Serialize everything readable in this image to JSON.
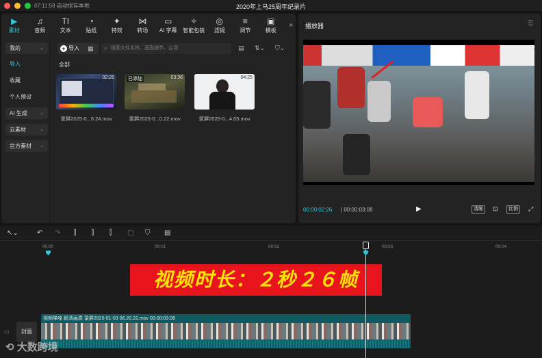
{
  "titlebar": {
    "time": "07:11:58",
    "autosave": "自动保存本地",
    "project_title": "2020年上马25周年纪录片"
  },
  "toolbar": [
    {
      "label": "素材",
      "icon": "media-icon",
      "glyph": "▶",
      "active": true
    },
    {
      "label": "音频",
      "icon": "audio-icon",
      "glyph": "♫"
    },
    {
      "label": "文本",
      "icon": "text-icon",
      "glyph": "TI"
    },
    {
      "label": "贴纸",
      "icon": "sticker-icon",
      "glyph": "◔"
    },
    {
      "label": "特效",
      "icon": "effects-icon",
      "glyph": "✦"
    },
    {
      "label": "转场",
      "icon": "transition-icon",
      "glyph": "⋈"
    },
    {
      "label": "AI 字幕",
      "icon": "ai-subtitle-icon",
      "glyph": "▭"
    },
    {
      "label": "智能包装",
      "icon": "smart-pack-icon",
      "glyph": "✧"
    },
    {
      "label": "滤镜",
      "icon": "filter-icon",
      "glyph": "◎"
    },
    {
      "label": "调节",
      "icon": "adjust-icon",
      "glyph": "≡"
    },
    {
      "label": "模板",
      "icon": "template-icon",
      "glyph": "▣"
    }
  ],
  "toolbar_more": "»",
  "sidenav": {
    "mine": "我的",
    "import": "导入",
    "favorites": "收藏",
    "personal_presets": "个人预设",
    "ai_generate": "AI 生成",
    "cloud": "云素材",
    "official": "官方素材"
  },
  "media": {
    "import_btn": "导入",
    "search_placeholder": "搜索文件名称、画面细节、台词",
    "all_label": "全部",
    "items": [
      {
        "name": "录屏2025-0...6.24.mov",
        "duration": "02:28",
        "badge": ""
      },
      {
        "name": "录屏2025-0...0.22.mov",
        "duration": "03:36",
        "badge": "已添加"
      },
      {
        "name": "录屏2025-0...4.05.mov",
        "duration": "04:25",
        "badge": ""
      }
    ]
  },
  "player": {
    "title": "播放器",
    "time_current": "00:00:02:26",
    "time_total": "00:00:03:08",
    "btn_quality": "清晰",
    "btn_ratio": "比例"
  },
  "timeline": {
    "ticks": [
      "00:00",
      "00:01",
      "00:02",
      "00:03",
      "00:04"
    ],
    "caption": "视频时长：２秒２６帧",
    "cover_label": "封面",
    "clip_label": "视频降噪   超清画质   录屏2025-01-03 06.20.22.mov   00:00:03:08"
  },
  "watermark": "大数跨境",
  "colors": {
    "accent": "#2ec5d6",
    "caption_bg": "#e8141c",
    "caption_text": "#ffe600",
    "clip": "#0e5a60"
  }
}
